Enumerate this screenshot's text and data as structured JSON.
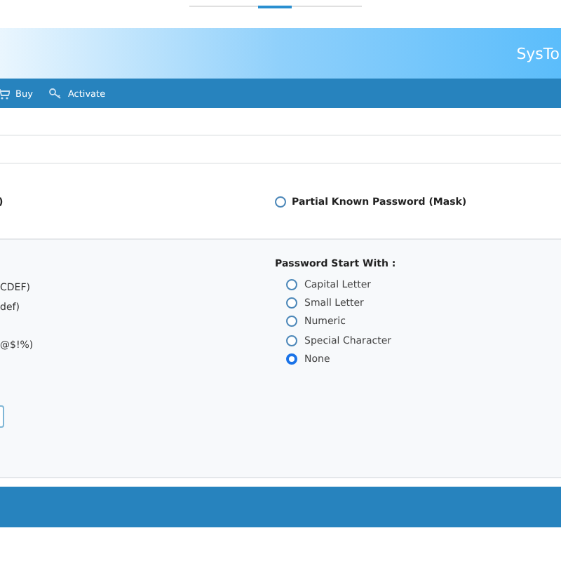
{
  "header": {
    "brand": "SysTo"
  },
  "toolbar": [
    {
      "kind": "cart",
      "label": "Buy"
    },
    {
      "kind": "key",
      "label": "Activate"
    }
  ],
  "modes": [
    {
      "kind": "text",
      "label": ")"
    },
    {
      "kind": "radio",
      "label": "Partial Known Password (Mask)",
      "selected": false
    }
  ],
  "left_options": [
    "CDEF)",
    "def)",
    "@$!%)"
  ],
  "start_with": {
    "title": "Password Start With :",
    "options": [
      {
        "label": "Capital Letter",
        "selected": false
      },
      {
        "label": "Small Letter",
        "selected": false
      },
      {
        "label": "Numeric",
        "selected": false
      },
      {
        "label": "Special Character",
        "selected": false
      },
      {
        "label": "None",
        "selected": true
      }
    ]
  }
}
